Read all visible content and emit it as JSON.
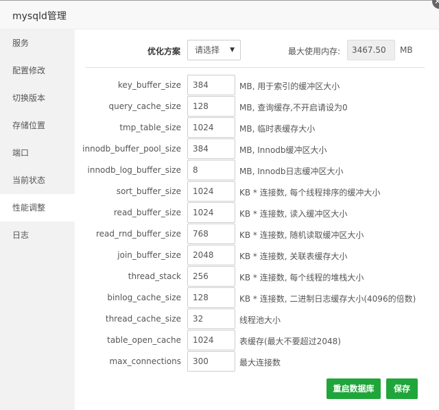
{
  "window": {
    "title": "mysqld管理",
    "close_icon": "close-icon"
  },
  "sidebar": {
    "items": [
      {
        "label": "服务"
      },
      {
        "label": "配置修改"
      },
      {
        "label": "切换版本"
      },
      {
        "label": "存储位置"
      },
      {
        "label": "端口"
      },
      {
        "label": "当前状态"
      },
      {
        "label": "性能调整",
        "active": true
      },
      {
        "label": "日志"
      }
    ]
  },
  "main": {
    "plan_label": "优化方案",
    "plan_select": "请选择",
    "mem_label": "最大使用内存:",
    "mem_value": "3467.50",
    "mem_unit": "MB",
    "rows": [
      {
        "label": "key_buffer_size",
        "value": "384",
        "desc": "MB, 用于索引的缓冲区大小"
      },
      {
        "label": "query_cache_size",
        "value": "128",
        "desc": "MB, 查询缓存,不开启请设为0"
      },
      {
        "label": "tmp_table_size",
        "value": "1024",
        "desc": "MB, 临时表缓存大小"
      },
      {
        "label": "innodb_buffer_pool_size",
        "value": "384",
        "desc": "MB, Innodb缓冲区大小"
      },
      {
        "label": "innodb_log_buffer_size",
        "value": "8",
        "desc": "MB, Innodb日志缓冲区大小"
      },
      {
        "label": "sort_buffer_size",
        "value": "1024",
        "desc": "KB * 连接数, 每个线程排序的缓冲大小"
      },
      {
        "label": "read_buffer_size",
        "value": "1024",
        "desc": "KB * 连接数, 读入缓冲区大小"
      },
      {
        "label": "read_rnd_buffer_size",
        "value": "768",
        "desc": "KB * 连接数, 随机读取缓冲区大小"
      },
      {
        "label": "join_buffer_size",
        "value": "2048",
        "desc": "KB * 连接数, 关联表缓存大小"
      },
      {
        "label": "thread_stack",
        "value": "256",
        "desc": "KB * 连接数, 每个线程的堆栈大小"
      },
      {
        "label": "binlog_cache_size",
        "value": "128",
        "desc": "KB * 连接数, 二进制日志缓存大小(4096的倍数)"
      },
      {
        "label": "thread_cache_size",
        "value": "32",
        "desc": "线程池大小"
      },
      {
        "label": "table_open_cache",
        "value": "1024",
        "desc": "表缓存(最大不要超过2048)"
      },
      {
        "label": "max_connections",
        "value": "300",
        "desc": "最大连接数"
      }
    ],
    "restart_label": "重启数据库",
    "save_label": "保存"
  },
  "colors": {
    "accent": "#20a53a"
  }
}
